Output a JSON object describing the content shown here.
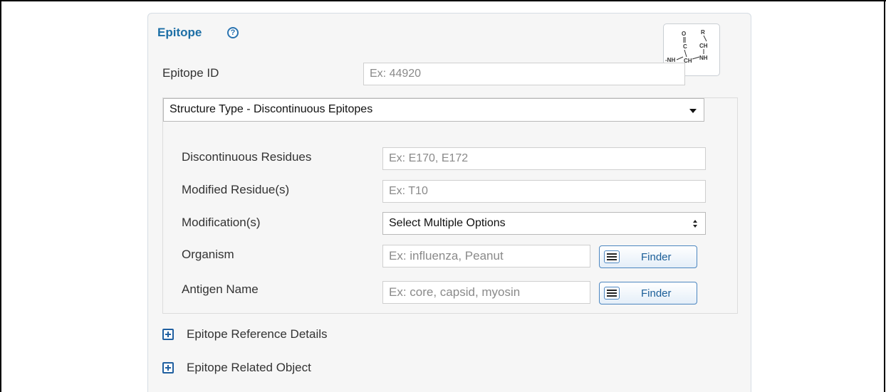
{
  "panel": {
    "title": "Epitope",
    "help_icon": "question-circle-icon",
    "structure_icon": "peptide-structure-icon",
    "accent_color": "#1d6fa6"
  },
  "epitope_id": {
    "label": "Epitope ID",
    "placeholder": "Ex: 44920"
  },
  "structure_type": {
    "selected": "Structure Type - Discontinuous Epitopes"
  },
  "fields": {
    "discontinuous_residues": {
      "label": "Discontinuous Residues",
      "placeholder": "Ex: E170, E172"
    },
    "modified_residues": {
      "label": "Modified Residue(s)",
      "placeholder": "Ex: T10"
    },
    "modifications": {
      "label": "Modification(s)",
      "selected": "Select Multiple Options"
    },
    "organism": {
      "label": "Organism",
      "placeholder": "Ex: influenza, Peanut",
      "finder_label": "Finder"
    },
    "antigen_name": {
      "label": "Antigen Name",
      "placeholder": "Ex: core, capsid, myosin",
      "finder_label": "Finder"
    }
  },
  "expanders": [
    {
      "label": "Epitope Reference Details",
      "icon": "plus-square-icon"
    },
    {
      "label": "Epitope Related Object",
      "icon": "plus-square-icon"
    }
  ]
}
